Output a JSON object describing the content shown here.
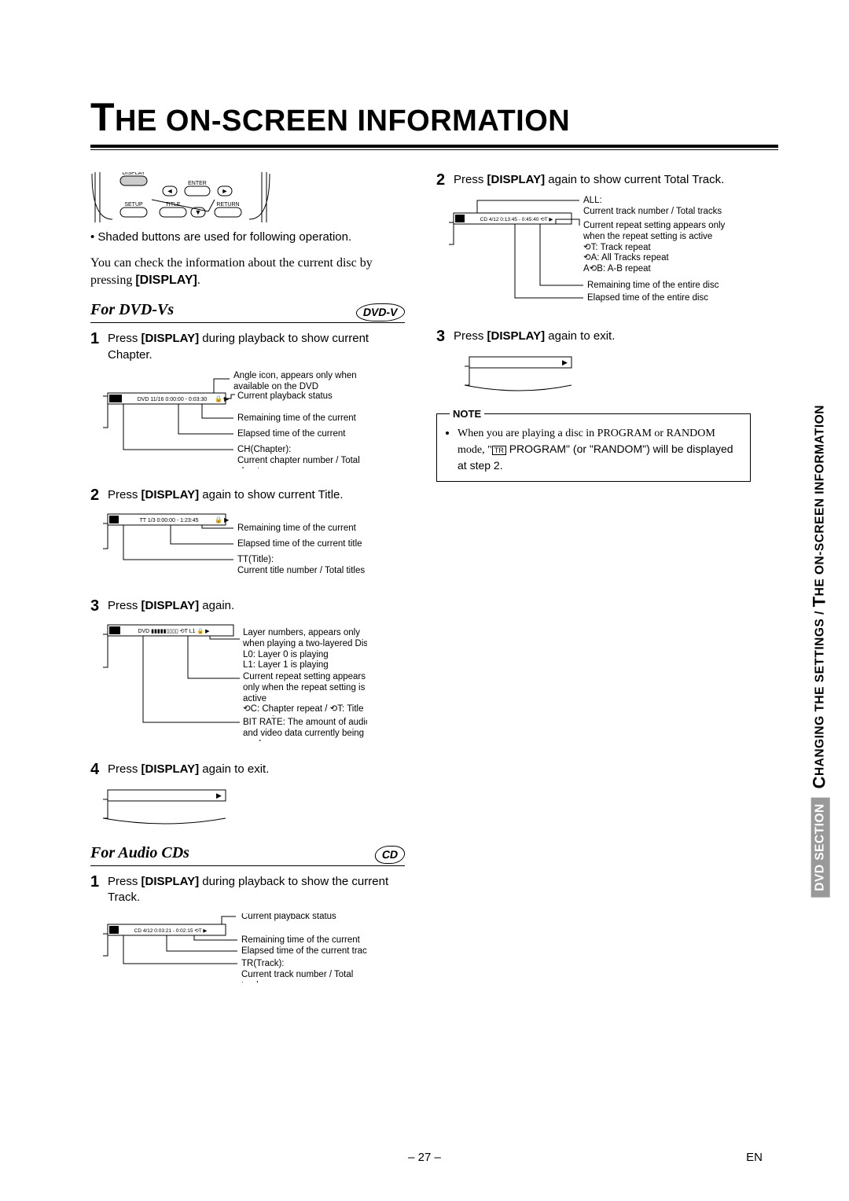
{
  "title_prefix": "T",
  "title_rest": "HE ON-SCREEN INFORMATION",
  "remote": {
    "display": "DISPLAY",
    "enter": "ENTER",
    "setup": "SETUP",
    "title": "TITLE",
    "return": "RETURN"
  },
  "intro_bullet": "Shaded buttons are used for following operation.",
  "intro_para": "You can check the information about the current disc by pressing ",
  "display_word": "[DISPLAY]",
  "period": ".",
  "section_dvd": "For DVD-Vs",
  "badge_dvd": "DVD-V",
  "section_cd": "For Audio CDs",
  "badge_cd": "CD",
  "dvd_steps": {
    "s1": "Press ",
    "s1b": " during playback to show current Chapter.",
    "s2": "Press ",
    "s2b": " again to show current Title.",
    "s3": "Press ",
    "s3b": " again.",
    "s4": "Press ",
    "s4b": " again to exit."
  },
  "dvd_diag1": {
    "osd": "DVD  11/16  0:00:00 - 0:03:30",
    "a1": "Angle icon, appears only when available on the DVD",
    "a2": "Current playback status",
    "a3": "Remaining time of the current chapter",
    "a4": "Elapsed time of the current chapter",
    "a5": "CH(Chapter):\nCurrent chapter number / Total chapters"
  },
  "dvd_diag2": {
    "osd": "TT  1/3   0:00:00 - 1:23:45",
    "a1": "Remaining time of the current title",
    "a2": "Elapsed time of the current title",
    "a3": "TT(Title):\nCurrent title number / Total titles"
  },
  "dvd_diag3": {
    "osd": "DVD  ▮▮▮▮▮▯▯▯▯   ⟲T  L1  🔒 ▶",
    "a1": "Layer numbers, appears only when playing a two-layered Disc\nL0: Layer 0 is playing\nL1: Layer 1 is playing",
    "a2": "Current repeat setting appears only when the repeat setting is active\n⟲C: Chapter repeat / ⟲T: Title repeat /\nA⟲B: A-B repeat",
    "a3": "BIT RATE: The amount of audio and video data currently being read"
  },
  "cd_steps": {
    "s1": "Press ",
    "s1b": " during playback to show the current Track.",
    "s2": "Press ",
    "s2b": " again to show current Total Track.",
    "s3": "Press ",
    "s3b": " again to exit."
  },
  "cd_diag1": {
    "osd": "CD  4/12  0:03:21 - 0:02:15  ⟲T  ▶",
    "a1": "Current playback status",
    "a2": "Remaining time of the current track",
    "a3": "Elapsed time of the current track",
    "a4": "TR(Track):\nCurrent track number / Total tracks"
  },
  "cd_diag2": {
    "osd": "CD  4/12  0:13:45 - 0:45:40  ⟲T  ▶",
    "a0": "ALL:\nCurrent track number / Total tracks",
    "a1": "Current repeat setting appears only when the repeat setting is active\n⟲T: Track repeat\n⟲A: All Tracks repeat\nA⟲B: A-B repeat",
    "a2": "Remaining time of the entire disc",
    "a3": "Elapsed time of the entire disc"
  },
  "note_label": "NOTE",
  "note_text_a": "When you are playing a disc in PROGRAM or RANDOM mode, \"",
  "note_text_b": "PROGRAM\" (or \"RANDOM\") will be displayed at step ",
  "note_step": "2",
  "side": {
    "box": "DVD SECTION",
    "rest_a": "C",
    "rest_b": "HANGING THE SETTINGS / ",
    "rest_c": "T",
    "rest_d": "HE ON-SCREEN INFORMATION"
  },
  "page_number": "– 27 –",
  "lang": "EN"
}
